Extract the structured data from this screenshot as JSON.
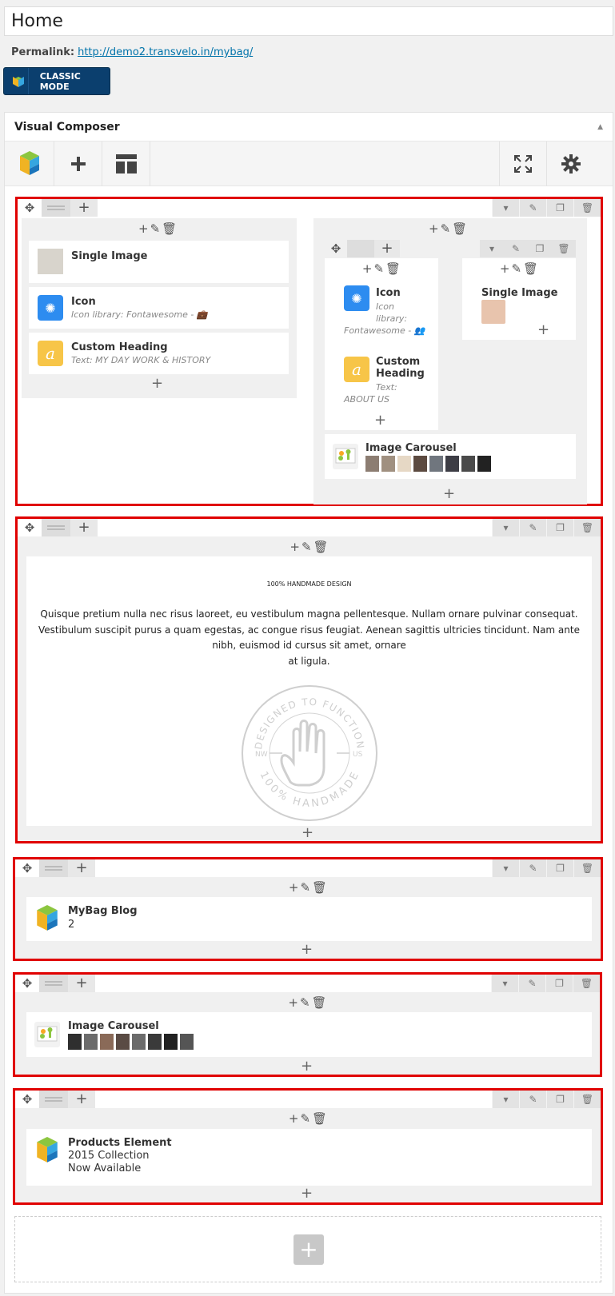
{
  "page": {
    "title": "Home",
    "permalink_label": "Permalink:",
    "permalink_url": "http://demo2.transvelo.in/mybag/",
    "classic_mode": "CLASSIC MODE"
  },
  "vc": {
    "title": "Visual Composer",
    "toggle": "▲",
    "nav": {
      "add_icon": "plus-icon",
      "templates_icon": "layout-icon",
      "fullscreen_icon": "fullscreen-icon",
      "settings_icon": "gear-icon"
    }
  },
  "row1": {
    "left": {
      "single_image": "Single Image",
      "icon_title": "Icon",
      "icon_sub": "Icon library: Fontawesome -",
      "heading_title": "Custom Heading",
      "heading_sub": "Text: MY DAY WORK & HISTORY"
    },
    "right": {
      "icon_title": "Icon",
      "icon_sub1": "Icon",
      "icon_sub2": "library:",
      "icon_sub3": "Fontawesome -",
      "heading_title1": "Custom",
      "heading_title2": "Heading",
      "heading_sub1": "Text:",
      "heading_sub2": "ABOUT US",
      "single_image": "Single Image",
      "carousel_title": "Image Carousel"
    }
  },
  "row2": {
    "heading": "100% HANDMADE DESIGN",
    "paragraph_line1": "Quisque pretium nulla nec risus laoreet, eu vestibulum magna pellentesque. Nullam ornare pulvinar consequat.",
    "paragraph_line2": "Vestibulum suscipit purus a quam egestas, ac congue risus feugiat. Aenean sagittis ultricies tincidunt. Nam ante",
    "paragraph_line3": "nibh, euismod id cursus sit amet, ornare",
    "paragraph_line4": "at ligula.",
    "stamp_top": "DESIGNED TO FUNCTION",
    "stamp_bottom": "100% HANDMADE",
    "stamp_left": "NW",
    "stamp_right": "US"
  },
  "row3": {
    "title": "MyBag Blog",
    "sub": "2"
  },
  "row4": {
    "title": "Image Carousel"
  },
  "row5": {
    "title": "Products Element",
    "sub1": "2015 Collection",
    "sub2": "Now Available"
  }
}
